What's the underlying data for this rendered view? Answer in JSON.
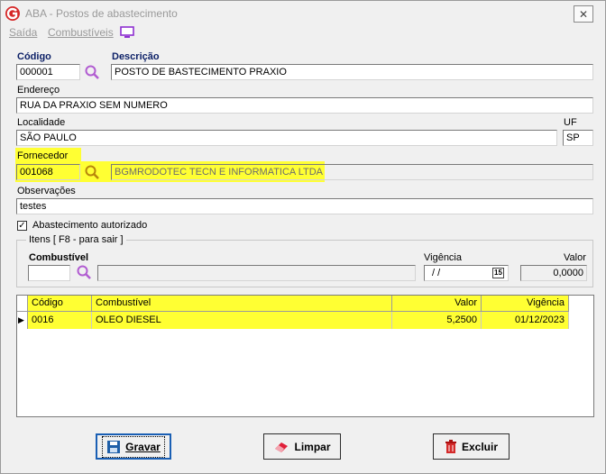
{
  "window": {
    "title": "ABA - Postos de abastecimento",
    "close_glyph": "✕",
    "app_icon": "g-logo-icon"
  },
  "menu": {
    "saida": "Saída",
    "combustiveis": "Combustíveis",
    "monitor_icon": "monitor-icon"
  },
  "form": {
    "codigo_label": "Código",
    "codigo_value": "000001",
    "descricao_label": "Descrição",
    "descricao_value": "POSTO DE BASTECIMENTO PRAXIO",
    "endereco_label": "Endereço",
    "endereco_value": "RUA DA PRAXIO SEM NUMERO",
    "localidade_label": "Localidade",
    "localidade_value": "SÃO PAULO",
    "uf_label": "UF",
    "uf_value": "SP",
    "fornecedor_label": "Fornecedor",
    "fornecedor_code": "001068",
    "fornecedor_name": "BGMRODOTEC TECN E INFORMATICA LTDA",
    "observacoes_label": "Observações",
    "observacoes_value": "testes",
    "autorizado_label": "Abastecimento autorizado",
    "autorizado_checked": true
  },
  "itens": {
    "group_title": "Itens [ F8 - para sair ]",
    "combustivel_label": "Combustível",
    "combustivel_code": "",
    "combustivel_desc": "",
    "vigencia_label": "Vigência",
    "vigencia_value": " /  /",
    "calendar_glyph": "15",
    "valor_label": "Valor",
    "valor_value": "0,0000"
  },
  "grid": {
    "columns": [
      "Código",
      "Combustível",
      "Valor",
      "Vigência"
    ],
    "rows": [
      {
        "codigo": "0016",
        "combustivel": "OLEO DIESEL",
        "valor": "5,2500",
        "vigencia": "01/12/2023"
      }
    ],
    "row_indicator": "▶"
  },
  "buttons": {
    "gravar": "Gravar",
    "limpar": "Limpar",
    "excluir": "Excluir"
  },
  "colors": {
    "highlight": "#ffff33",
    "label_blue": "#0b1f66",
    "search_purple": "#b15cd1"
  }
}
